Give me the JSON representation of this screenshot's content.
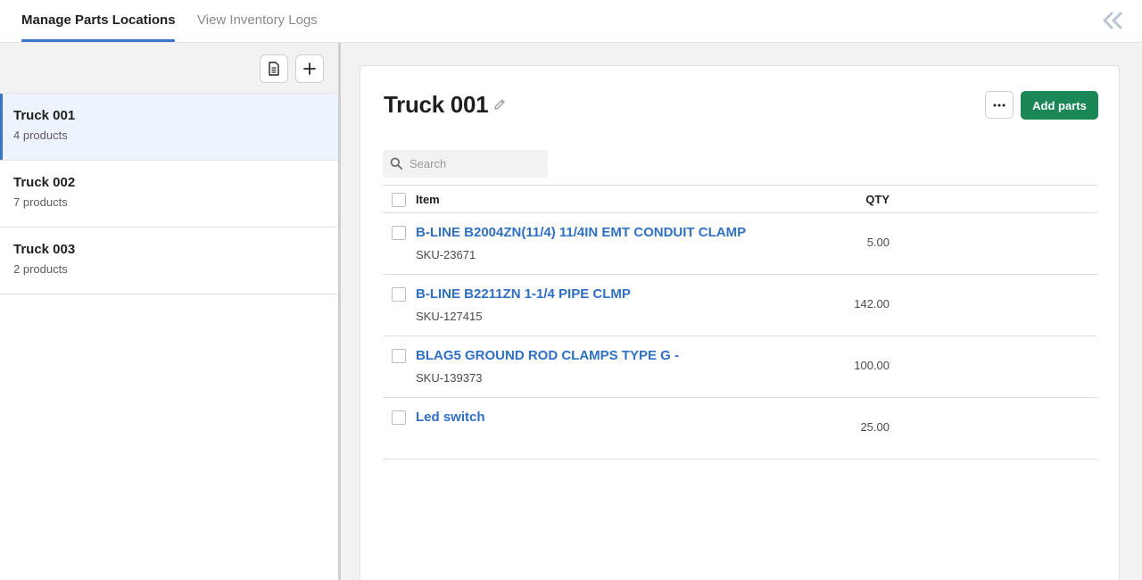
{
  "tabs": [
    {
      "label": "Manage Parts Locations",
      "active": true
    },
    {
      "label": "View Inventory Logs",
      "active": false
    }
  ],
  "colors": {
    "accent": "#3b73c8",
    "primary_button": "#1c8756",
    "link": "#2f6fc4"
  },
  "sidebar": {
    "locations": [
      {
        "name": "Truck 001",
        "count": "4 products",
        "selected": true
      },
      {
        "name": "Truck 002",
        "count": "7 products",
        "selected": false
      },
      {
        "name": "Truck 003",
        "count": "2 products",
        "selected": false
      }
    ]
  },
  "main": {
    "title": "Truck 001",
    "add_parts_label": "Add parts",
    "more_label": "···",
    "search": {
      "placeholder": "Search",
      "value": ""
    },
    "table": {
      "headers": {
        "item": "Item",
        "qty": "QTY"
      },
      "rows": [
        {
          "name": "B-LINE B2004ZN(11/4) 11/4IN EMT CONDUIT CLAMP",
          "sku": "SKU-23671",
          "qty": "5.00"
        },
        {
          "name": "B-LINE B2211ZN 1-1/4 PIPE CLMP",
          "sku": "SKU-127415",
          "qty": "142.00"
        },
        {
          "name": "BLAG5 GROUND ROD CLAMPS TYPE G -",
          "sku": "SKU-139373",
          "qty": "100.00"
        },
        {
          "name": "Led switch",
          "sku": "",
          "qty": "25.00"
        }
      ]
    }
  }
}
